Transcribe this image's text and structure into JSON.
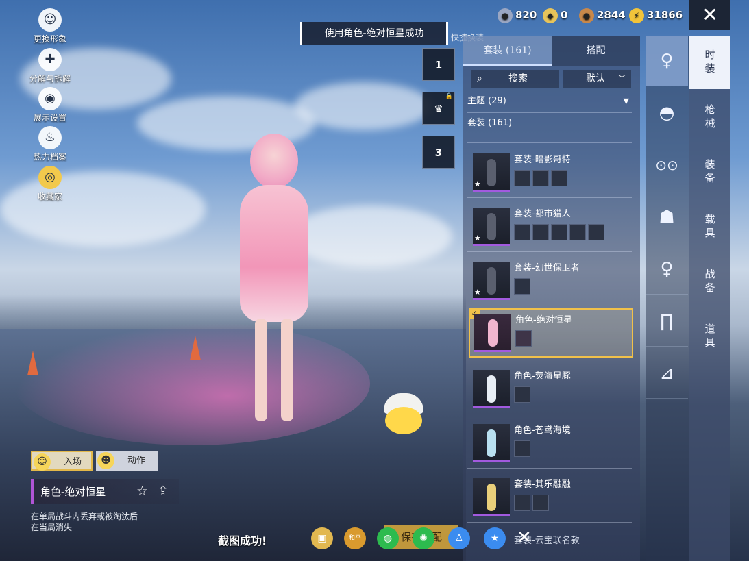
{
  "top_bar": {
    "currencies": [
      {
        "icon": "silver-coin-icon",
        "value": "820",
        "color": "#9aa6c2"
      },
      {
        "icon": "gold-badge-icon",
        "value": "0",
        "color": "#e8c45a"
      },
      {
        "icon": "bronze-coin-icon",
        "value": "2844",
        "color": "#c8884a"
      },
      {
        "icon": "lightning-coin-icon",
        "value": "31866",
        "color": "#f2c43a"
      }
    ],
    "close_glyph": "✕"
  },
  "left_menu": [
    {
      "icon": "avatar-change-icon",
      "glyph": "☺",
      "label": "更换形象"
    },
    {
      "icon": "puzzle-icon",
      "glyph": "✚",
      "label": "分解与拆解"
    },
    {
      "icon": "eye-icon",
      "glyph": "◉",
      "label": "展示设置"
    },
    {
      "icon": "flame-icon",
      "glyph": "♨",
      "label": "热力档案"
    },
    {
      "icon": "collector-icon",
      "glyph": "◎",
      "label": "收藏家"
    }
  ],
  "toast": {
    "text": "使用角色-绝对恒星成功",
    "tail": "快捷换装"
  },
  "slots": [
    {
      "number": "1",
      "locked": false
    },
    {
      "number": "",
      "locked": true
    },
    {
      "number": "3",
      "locked": false
    }
  ],
  "panel": {
    "tabs": [
      {
        "label": "套装 (161)"
      },
      {
        "label": "搭配"
      }
    ],
    "search": {
      "label": "搜索"
    },
    "sort": {
      "label": "默认"
    },
    "theme": {
      "label": "主题 (29)"
    },
    "suit_count": "套装 (161)",
    "items": [
      {
        "name": "套装-暗影哥特",
        "parts": 3,
        "star": true,
        "selected": false
      },
      {
        "name": "套装-都市猎人",
        "parts": 5,
        "star": true,
        "selected": false
      },
      {
        "name": "套装-幻世保卫者",
        "parts": 1,
        "star": true,
        "selected": false
      },
      {
        "name": "角色-绝对恒星",
        "parts": 1,
        "star": false,
        "selected": true
      },
      {
        "name": "角色-荧海星豚",
        "parts": 1,
        "star": false,
        "selected": false
      },
      {
        "name": "角色-苍鸢海境",
        "parts": 1,
        "star": false,
        "selected": false
      },
      {
        "name": "套装-其乐融融",
        "parts": 2,
        "star": false,
        "selected": false
      }
    ],
    "partial_item": "套装-云宝联名款"
  },
  "categories": [
    {
      "icon": "character-icon",
      "glyph": "♀"
    },
    {
      "icon": "cap-icon",
      "glyph": "◓"
    },
    {
      "icon": "glasses-icon",
      "glyph": "⊙⊙"
    },
    {
      "icon": "mask-icon",
      "glyph": "☗"
    },
    {
      "icon": "dress-icon",
      "glyph": "♀"
    },
    {
      "icon": "pants-icon",
      "glyph": "∏"
    },
    {
      "icon": "shoes-icon",
      "glyph": "⊿"
    }
  ],
  "sub_categories": [
    {
      "label": "时\n装"
    },
    {
      "label": "枪\n械"
    },
    {
      "label": "装\n备"
    },
    {
      "label": "载\n具"
    },
    {
      "label": "战\n备"
    },
    {
      "label": "道\n具"
    }
  ],
  "bottom_left": {
    "entry_label": "入场",
    "action_label": "动作",
    "character_name": "角色-绝对恒星",
    "description_line1": "在单局战斗内丢弃或被淘汰后",
    "description_line2": "在当局消失"
  },
  "bottom_bar": {
    "screenshot_text": "截图成功!",
    "save_label": "保存搭配",
    "share_targets": [
      {
        "icon": "album-icon",
        "color": "#e2b850"
      },
      {
        "icon": "peace-elite-icon",
        "color": "#d99a2e"
      },
      {
        "icon": "wechat-icon",
        "color": "#2dbb4e"
      },
      {
        "icon": "moments-icon",
        "color": "#2dbb4e"
      },
      {
        "icon": "qq-icon",
        "color": "#3b8cf0"
      },
      {
        "icon": "qzone-icon",
        "color": "#3b8cf0"
      }
    ],
    "close_glyph": "✕"
  }
}
